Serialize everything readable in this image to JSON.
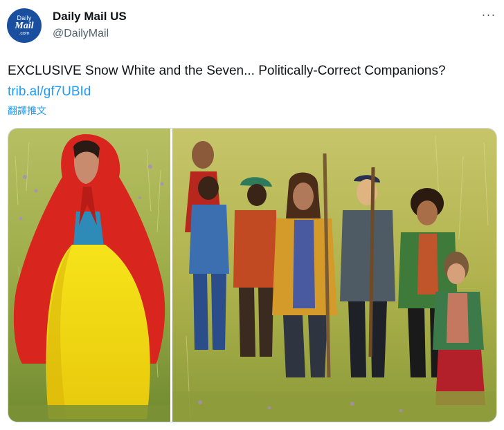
{
  "account": {
    "avatar_lines": [
      "Daily",
      "Mail",
      ".com"
    ],
    "display_name": "Daily Mail US",
    "handle": "@DailyMail"
  },
  "tweet": {
    "text": "EXCLUSIVE Snow White and the Seven... Politically-Correct Companions? ",
    "link_text": "trib.al/gf7UBId",
    "translate_label": "翻譯推文"
  },
  "media": {
    "photo_count": 2
  },
  "icons": {
    "more": "more-horizontal-icon"
  },
  "colors": {
    "link": "#1d9bf0",
    "text": "#0f1419",
    "muted": "#536471",
    "avatar_bg": "#1a4fa0",
    "border": "#cfd9de"
  }
}
